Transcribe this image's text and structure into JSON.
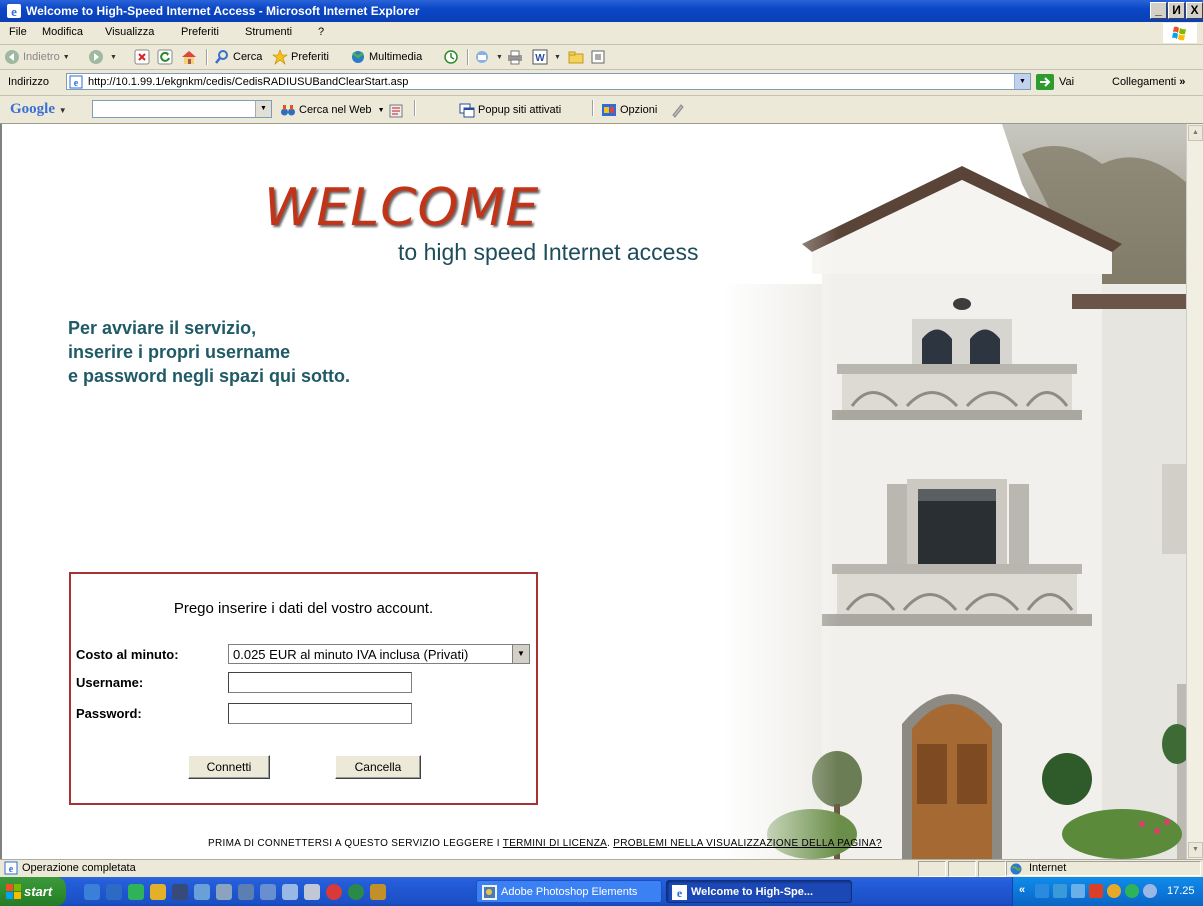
{
  "window": {
    "title": "Welcome to High-Speed Internet Access - Microsoft Internet Explorer",
    "controls": [
      "_",
      "И",
      "X"
    ]
  },
  "menu": [
    "File",
    "Modifica",
    "Visualizza",
    "Preferiti",
    "Strumenti",
    "?"
  ],
  "toolbar": {
    "back": "Indietro",
    "search": "Cerca",
    "favorites": "Preferiti",
    "media": "Multimedia"
  },
  "address": {
    "label": "Indirizzo",
    "url": "http://10.1.99.1/ekgnkm/cedis/CedisRADIUSUBandClearStart.asp",
    "go": "Vai",
    "links": "Collegamenti",
    "links_more": "»"
  },
  "google": {
    "logo": "Google",
    "search_web": "Cerca nel Web",
    "popup": "Popup siti attivati",
    "options": "Opzioni"
  },
  "page": {
    "welcome": "WELCOME",
    "subtitle": "to high speed Internet access",
    "instructions": [
      "Per avviare il servizio,",
      "inserire i propri username",
      "e password negli spazi qui sotto."
    ],
    "login": {
      "heading": "Prego inserire i dati del vostro account.",
      "cost_label": "Costo al minuto:",
      "cost_value": "0.025 EUR al minuto IVA inclusa (Privati)",
      "username_label": "Username:",
      "password_label": "Password:",
      "username_value": "",
      "password_value": "",
      "connect": "Connetti",
      "cancel": "Cancella"
    },
    "footer": {
      "prefix": "PRIMA DI CONNETTERSI A QUESTO SERVIZIO LEGGERE I ",
      "license": "TERMINI DI LICENZA",
      "sep": ". ",
      "problems": "PROBLEMI NELLA VISUALIZZAZIONE DELLA PAGINA?"
    }
  },
  "status": {
    "text": "Operazione completata",
    "zone": "Internet"
  },
  "taskbar": {
    "start": "start",
    "tasks": [
      "Adobe Photoshop Elements",
      "Welcome to High-Spe..."
    ],
    "tray_more": "«",
    "clock": "17.25"
  }
}
